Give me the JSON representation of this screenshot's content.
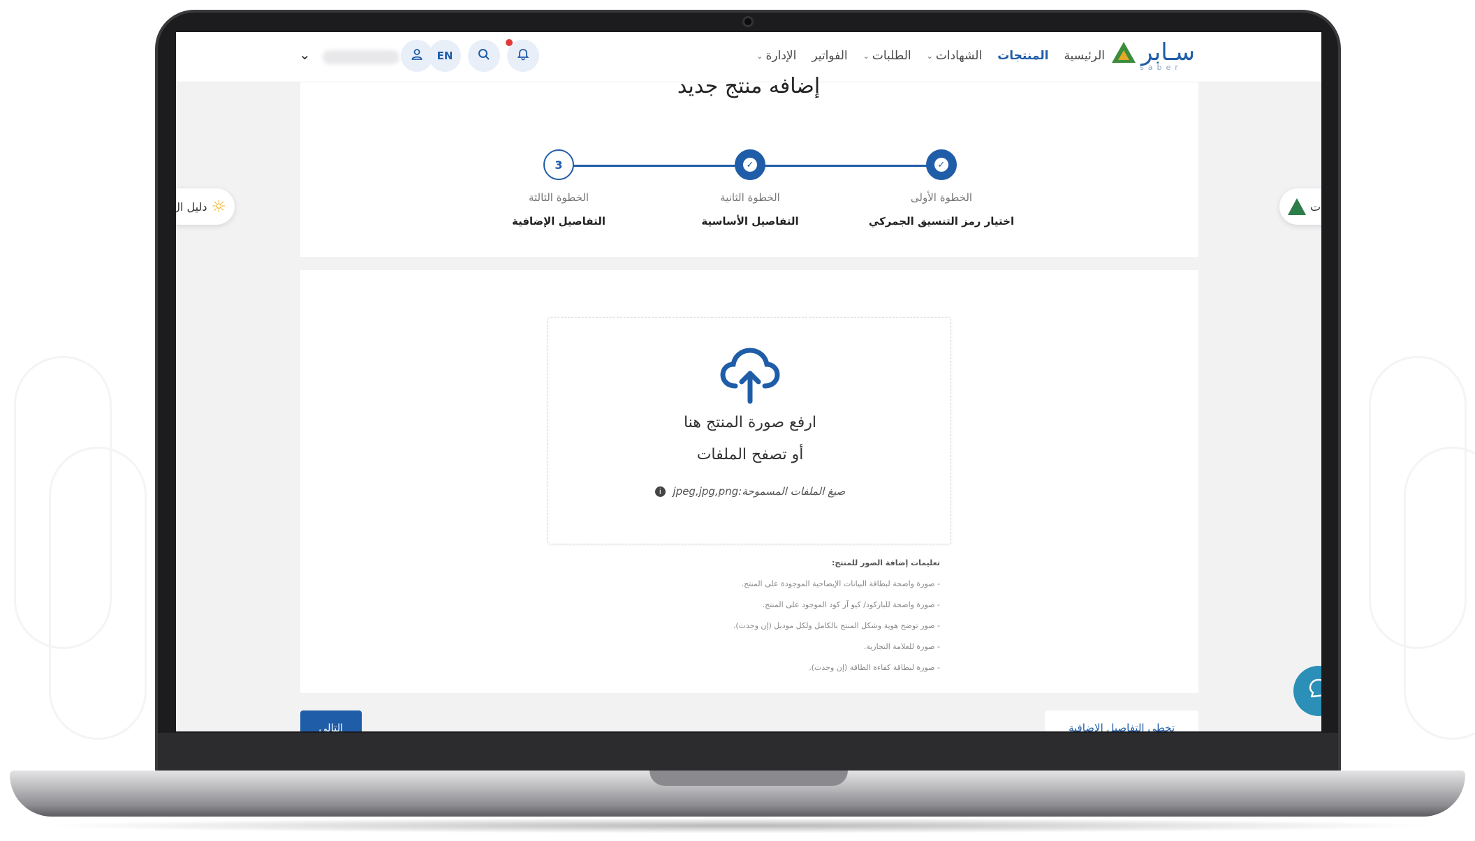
{
  "navbar": {
    "logo_text": "سـابر",
    "logo_sub": "saber",
    "menu": [
      {
        "label": "الرئيسية",
        "active": false,
        "dropdown": false
      },
      {
        "label": "المنتجات",
        "active": true,
        "dropdown": false
      },
      {
        "label": "الشهادات",
        "active": false,
        "dropdown": true
      },
      {
        "label": "الطلبات",
        "active": false,
        "dropdown": true
      },
      {
        "label": "الفواتير",
        "active": false,
        "dropdown": false
      },
      {
        "label": "الإدارة",
        "active": false,
        "dropdown": true
      }
    ],
    "lang_label": "EN",
    "icons": {
      "notifications": "bell-icon",
      "search": "search-icon",
      "user": "user-icon",
      "dropdown": "chevron-down-icon"
    }
  },
  "side": {
    "left_pill_text": "دليل ال",
    "right_pill_text": "ات"
  },
  "page": {
    "title": "إضافه منتج جديد"
  },
  "stepper": {
    "steps": [
      {
        "number_label": "الخطوة الأولى",
        "name": "اختيار رمز التنسيق الجمركي",
        "status": "done"
      },
      {
        "number_label": "الخطوة الثانية",
        "name": "التفاصيل الأساسية",
        "status": "done"
      },
      {
        "number_label": "الخطوة الثالثة",
        "name": "التفاصيل الإضافية",
        "status": "current",
        "index": "3"
      }
    ],
    "check_glyph": "✓"
  },
  "upload": {
    "main_text": "ارفع صورة المنتج هنا",
    "browse_text": "أو تصفح الملفات",
    "formats_text": "صيغ الملفات المسموحة:jpeg,jpg,png"
  },
  "instructions": {
    "title": "تعليمات إضافة الصور للمنتج:",
    "items": [
      "- صورة واضحة لبطاقة البيانات الإيضاحية الموجودة على المنتج.",
      "- صورة واضحة للباركود/ كيو آر كود الموجود على المنتج.",
      "- صور توضح هوية وشكل المنتج بالكامل ولكل موديل (إن وجدت).",
      "- صورة للعلامة التجارية.",
      "- صورة لبطاقة كفاءة الطاقة (إن وجدت)."
    ]
  },
  "buttons": {
    "next_label": "التالي",
    "skip_label": "تخطي التفاصيل الإضافية"
  },
  "colors": {
    "brand": "#1f5da8",
    "chat": "#2b8fb8"
  }
}
